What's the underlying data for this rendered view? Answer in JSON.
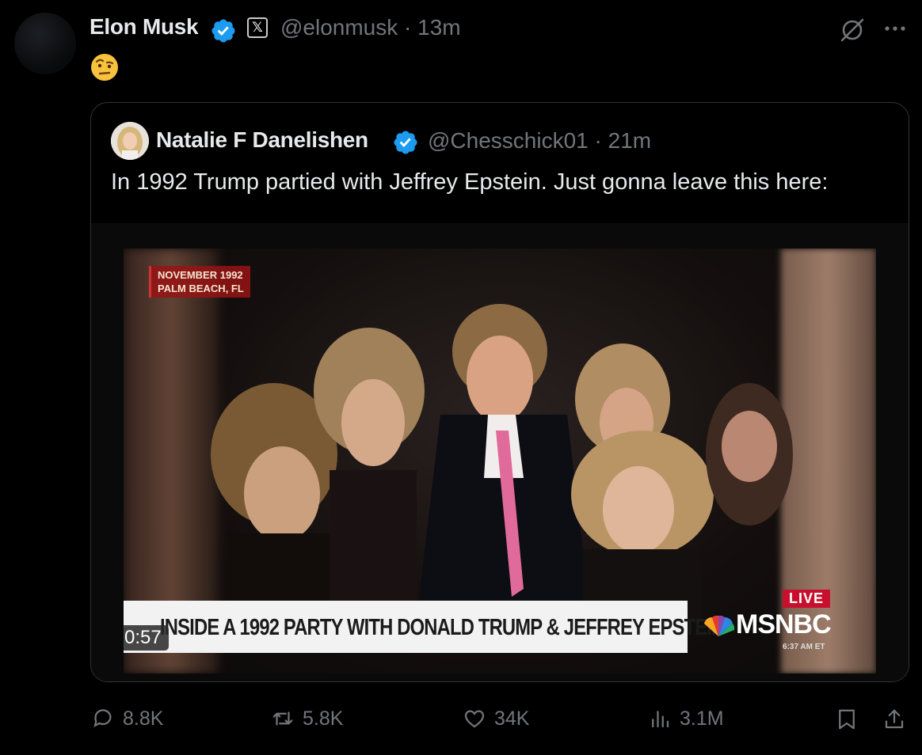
{
  "post": {
    "author_name": "Elon Musk",
    "handle": "@elonmusk",
    "time": "· 13m",
    "text_emoji": "🤨"
  },
  "quoted": {
    "author_name": "Natalie F Danelishen",
    "handle": "@Chesschick01",
    "time": "· 21m",
    "text": "In 1992 Trump partied with Jeffrey Epstein. Just gonna leave this here:",
    "video": {
      "dateline_1": "NOVEMBER 1992",
      "dateline_2": "PALM BEACH, FL",
      "chyron": "INSIDE A 1992 PARTY WITH DONALD TRUMP & JEFFREY EPSTEIN",
      "live_label": "LIVE",
      "network": "MSNBC",
      "network_time": "6:37 AM ET",
      "duration": "0:57"
    }
  },
  "actions": {
    "replies": "8.8K",
    "reposts": "5.8K",
    "likes": "34K",
    "views": "3.1M"
  },
  "colors": {
    "background": "#000000",
    "text": "#e7e9ea",
    "muted": "#71767b",
    "verified": "#1d9bf0",
    "border": "#2f3336"
  }
}
